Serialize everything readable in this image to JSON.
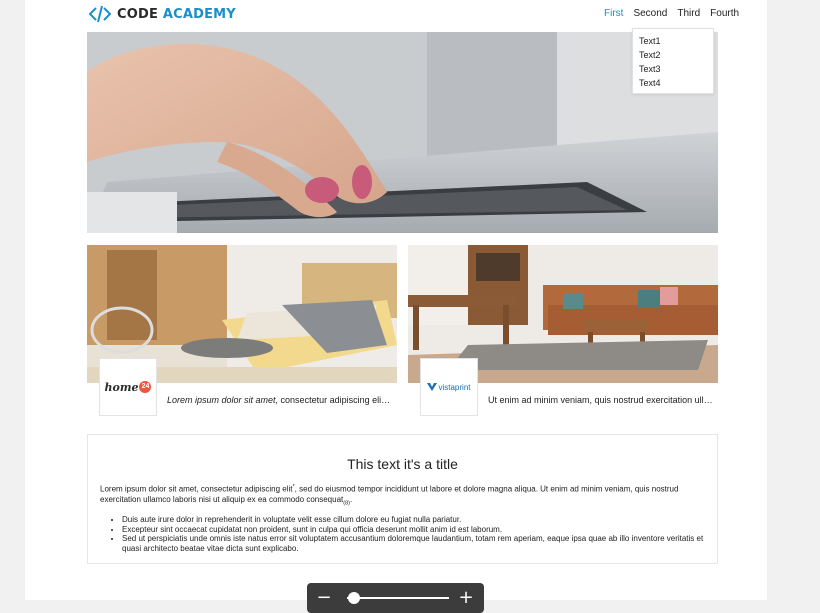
{
  "header": {
    "logo_prefix": "CODE",
    "logo_accent": "ACADEMY",
    "brand_color": "#1a8fc9"
  },
  "nav": {
    "items": [
      "First",
      "Second",
      "Third",
      "Fourth"
    ],
    "active": "First"
  },
  "dropdown": {
    "items": [
      "Text1",
      "Text2",
      "Text3",
      "Text4"
    ]
  },
  "hero": {
    "image": "hands-typing-on-laptop"
  },
  "cards": [
    {
      "image": "bedroom-interior",
      "logo_text": "home",
      "logo_badge": "24",
      "text_italic": "Lorem ipsum dolor sit amet,",
      "text_rest": " consectetur adipiscing elit, se..."
    },
    {
      "image": "living-room-interior",
      "logo_text": "vistaprint",
      "logo_suffix": ".",
      "text_italic": "",
      "text_rest": "Ut enim ad minim veniam, quis nostrud exercitation ullam..."
    }
  ],
  "content": {
    "title": "This text it's a title",
    "para_part1": "Lorem ipsum dolor sit amet, consectetur adipiscing elit",
    "para_sup": "*",
    "para_part2": ", sed do eiusmod tempor incididunt ut labore et dolore magna aliqua. Ut enim ad minim veniam, quis nostrud exercitation ullamco laboris nisi ut aliquip ex ea commodo consequat",
    "para_sub": "(8)",
    "para_end": ".",
    "list": [
      "Duis aute irure dolor in reprehenderit in voluptate velit esse cillum dolore eu fugiat nulla pariatur.",
      "Excepteur sint occaecat cupidatat non proident, sunt in culpa qui officia deserunt mollit anim id est laborum.",
      "Sed ut perspiciatis unde omnis iste natus error sit voluptatem accusantium doloremque laudantium, totam rem aperiam, eaque ipsa quae ab illo inventore veritatis et quasi architecto beatae vitae dicta sunt explicabo."
    ]
  },
  "zoom": {
    "minus_label": "−",
    "plus_label": "+",
    "level": 0.07
  }
}
